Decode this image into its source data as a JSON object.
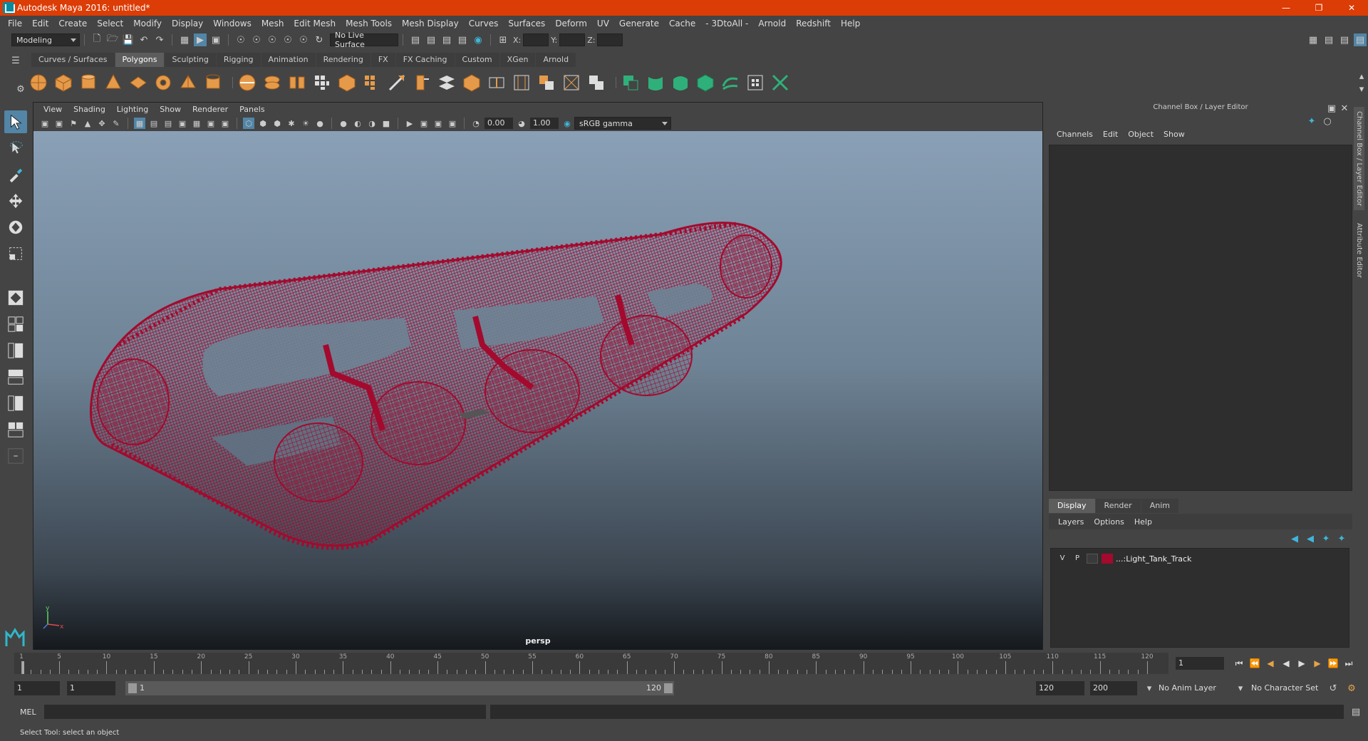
{
  "titlebar": {
    "title": "Autodesk Maya 2016: untitled*",
    "buttons": [
      "minimize",
      "restore",
      "close"
    ],
    "color": "#dc3c05"
  },
  "menubar": {
    "items": [
      "File",
      "Edit",
      "Create",
      "Select",
      "Modify",
      "Display",
      "Windows",
      "Mesh",
      "Edit Mesh",
      "Mesh Tools",
      "Mesh Display",
      "Curves",
      "Surfaces",
      "Deform",
      "UV",
      "Generate",
      "Cache",
      "- 3DtoAll -",
      "Arnold",
      "Redshift",
      "Help"
    ]
  },
  "statusline": {
    "mode": "Modeling",
    "live_surface": "No Live Surface",
    "x_label": "X:",
    "y_label": "Y:",
    "z_label": "Z:"
  },
  "shelf": {
    "tabs": [
      "Curves / Surfaces",
      "Polygons",
      "Sculpting",
      "Rigging",
      "Animation",
      "Rendering",
      "FX",
      "FX Caching",
      "Custom",
      "XGen",
      "Arnold"
    ],
    "active_tab": "Polygons"
  },
  "viewport": {
    "menu": [
      "View",
      "Shading",
      "Lighting",
      "Show",
      "Renderer",
      "Panels"
    ],
    "exposure": "0.00",
    "gamma": "1.00",
    "color_space": "sRGB gamma",
    "camera_label": "persp",
    "wire_color": "#a30a2e",
    "axis_y": "y",
    "axis_x": "x"
  },
  "channel_box": {
    "header": "Channel Box / Layer Editor",
    "menu": [
      "Channels",
      "Edit",
      "Object",
      "Show"
    ],
    "side_tabs": [
      "Channel Box / Layer Editor",
      "Attribute Editor"
    ]
  },
  "layer_editor": {
    "tabs": [
      "Display",
      "Render",
      "Anim"
    ],
    "active_tab": "Display",
    "menu": [
      "Layers",
      "Options",
      "Help"
    ],
    "layers": [
      {
        "v": "V",
        "p": "P",
        "color": "#a30a2e",
        "name": "...:Light_Tank_Track"
      }
    ]
  },
  "timeslider": {
    "ticks": [
      "1",
      "5",
      "10",
      "15",
      "20",
      "25",
      "30",
      "35",
      "40",
      "45",
      "50",
      "55",
      "60",
      "65",
      "70",
      "75",
      "80",
      "85",
      "90",
      "95",
      "100",
      "105",
      "110",
      "115",
      "120"
    ],
    "current_frame": "1"
  },
  "range": {
    "start": "1",
    "inner_start": "1",
    "slider_start": "1",
    "slider_end": "120",
    "end": "120",
    "anim_end": "200",
    "anim_layer": "No Anim Layer",
    "character_set": "No Character Set"
  },
  "cmdline": {
    "label": "MEL"
  },
  "helpline": {
    "text": "Select Tool: select an object"
  }
}
